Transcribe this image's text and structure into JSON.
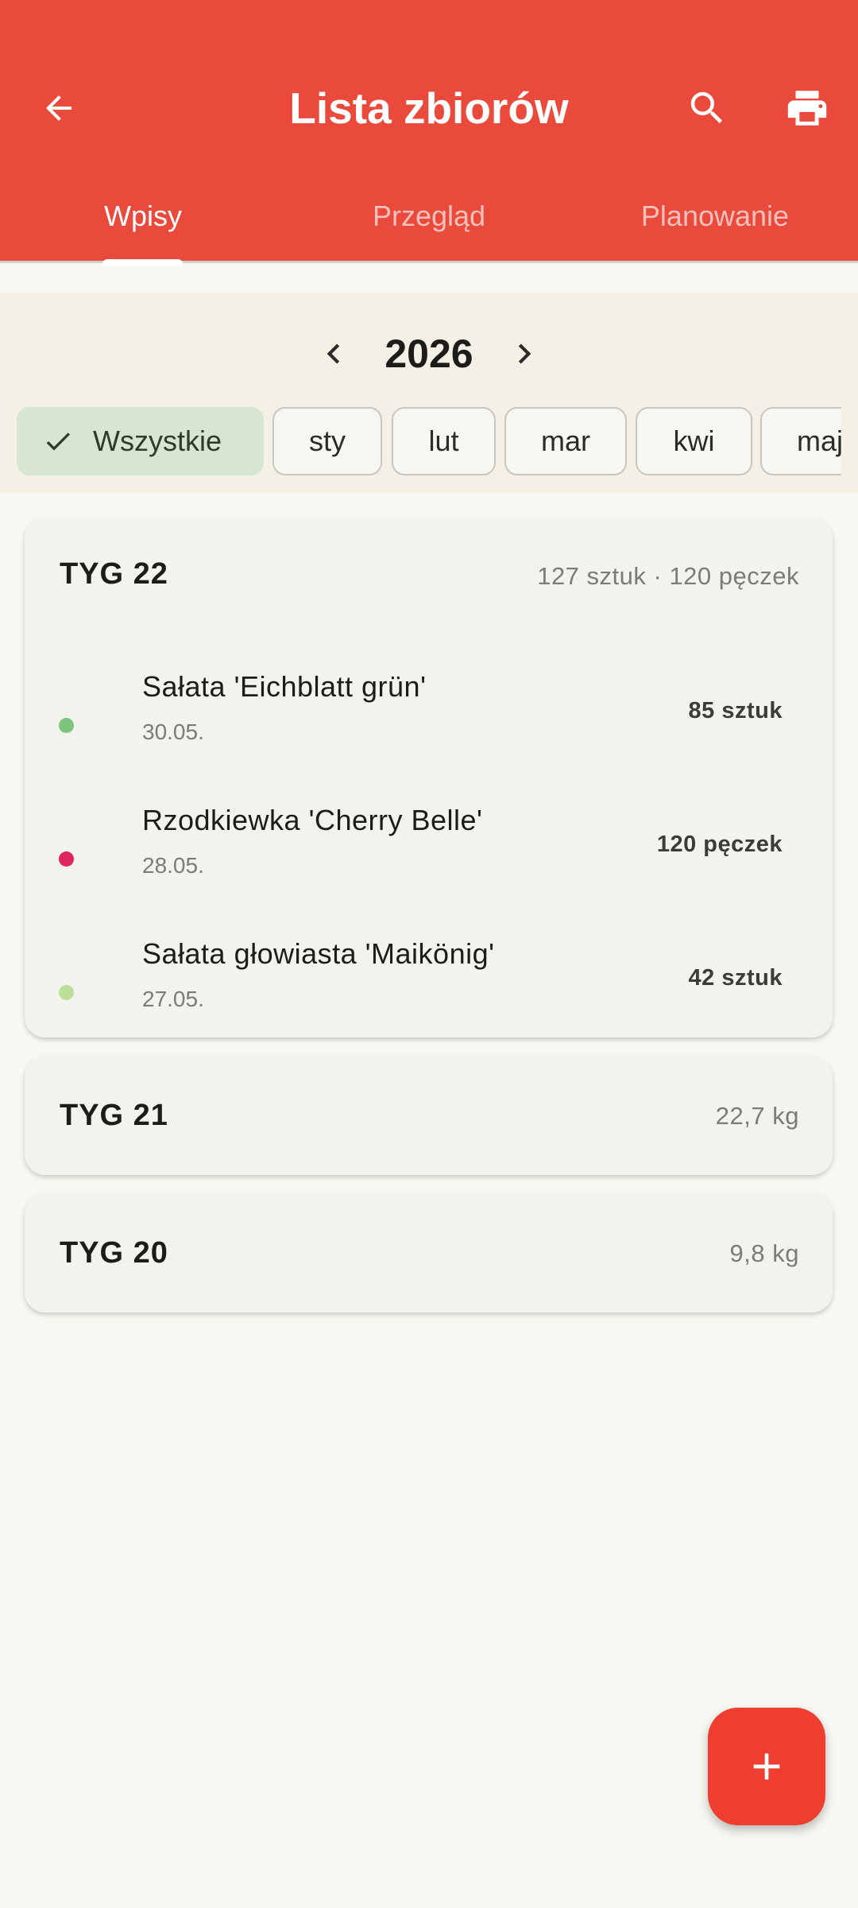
{
  "app_bar": {
    "title": "Lista zbiorów",
    "back_icon": "arrow-left-icon",
    "search_icon": "search-icon",
    "print_icon": "print-icon",
    "background_color": "#e94a3b"
  },
  "tabs": [
    {
      "label": "Wpisy",
      "active": true
    },
    {
      "label": "Przegląd",
      "active": false
    },
    {
      "label": "Planowanie",
      "active": false
    }
  ],
  "year_selector": {
    "year": "2026",
    "prev_icon": "chevron-left-icon",
    "next_icon": "chevron-right-icon"
  },
  "month_filters": [
    {
      "label": "Wszystkie",
      "selected": true
    },
    {
      "label": "sty",
      "selected": false
    },
    {
      "label": "lut",
      "selected": false
    },
    {
      "label": "mar",
      "selected": false
    },
    {
      "label": "kwi",
      "selected": false
    },
    {
      "label": "maj",
      "selected": false
    }
  ],
  "weeks": [
    {
      "label": "TYG 22",
      "summary": "127 sztuk · 120 pęczek",
      "expanded": true,
      "entries": [
        {
          "name": "Sałata 'Eichblatt grün'",
          "date": "30.05.",
          "amount": "85 sztuk",
          "color": "#7dc47d"
        },
        {
          "name": "Rzodkiewka 'Cherry Belle'",
          "date": "28.05.",
          "amount": "120 pęczek",
          "color": "#e0245e"
        },
        {
          "name": "Sałata głowiasta 'Maikönig'",
          "date": "27.05.",
          "amount": "42 sztuk",
          "color": "#bcdf99"
        }
      ]
    },
    {
      "label": "TYG 21",
      "summary": "22,7 kg",
      "expanded": false,
      "entries": []
    },
    {
      "label": "TYG 20",
      "summary": "9,8 kg",
      "expanded": false,
      "entries": []
    }
  ],
  "fab": {
    "icon": "plus-icon",
    "color": "#ef3d2f"
  }
}
